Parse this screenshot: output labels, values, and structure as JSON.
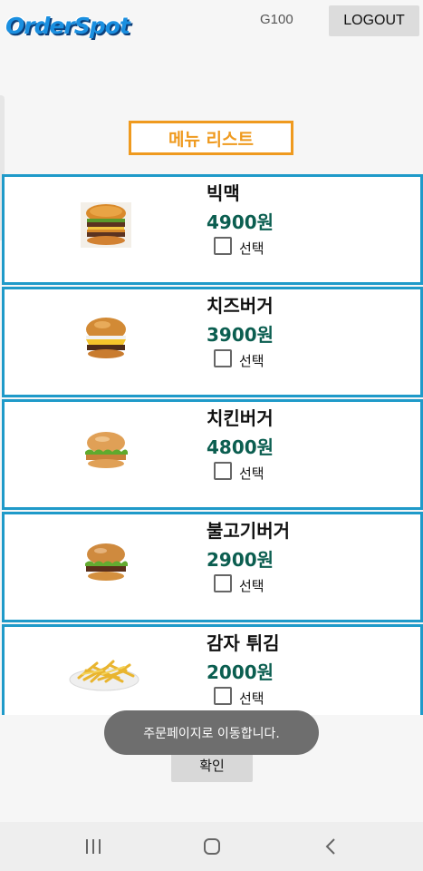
{
  "header": {
    "logo_text": "OrderSpot",
    "store_code": "G100",
    "logout_label": "LOGOUT"
  },
  "menu_title": "메뉴 리스트",
  "menu_items": [
    {
      "name": "빅맥",
      "price": "4900원",
      "select_label": "선택",
      "image": "bigmac-burger",
      "checked": false
    },
    {
      "name": "치즈버거",
      "price": "3900원",
      "select_label": "선택",
      "image": "cheese-burger",
      "checked": false
    },
    {
      "name": "치킨버거",
      "price": "4800원",
      "select_label": "선택",
      "image": "chicken-burger",
      "checked": false
    },
    {
      "name": "불고기버거",
      "price": "2900원",
      "select_label": "선택",
      "image": "bulgogi-burger",
      "checked": false
    },
    {
      "name": "감자 튀김",
      "price": "2000원",
      "select_label": "선택",
      "image": "french-fries",
      "checked": false
    }
  ],
  "toast_message": "주문페이지로 이동합니다.",
  "confirm_label": "확인",
  "navigation": {
    "recent_apps": "recent-apps-icon",
    "home": "home-icon",
    "back": "back-icon"
  },
  "colors": {
    "accent_orange": "#ef9a1f",
    "list_border": "#1f9ac9",
    "price_green": "#0b5e50",
    "logo_blue": "#1a8fe0"
  }
}
